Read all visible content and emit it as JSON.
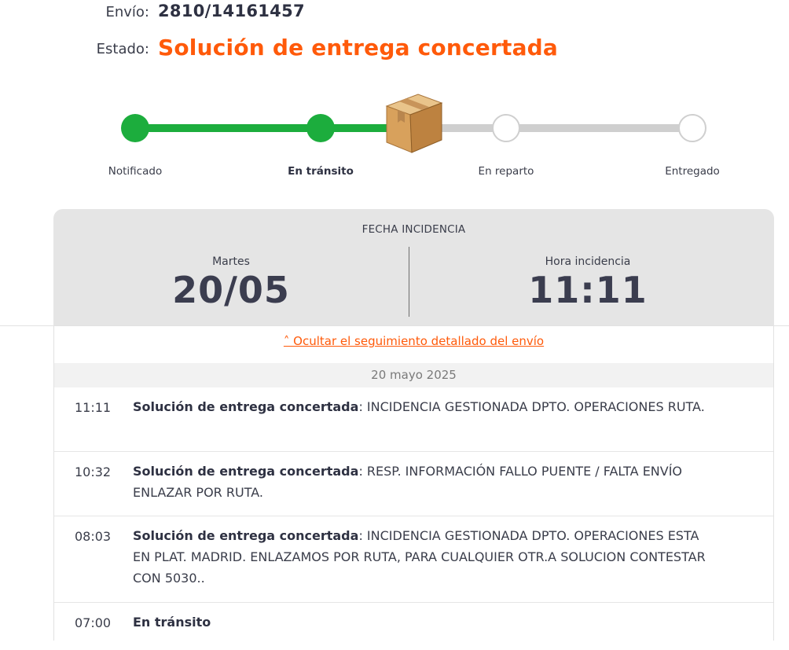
{
  "shipment": {
    "label": "Envío:",
    "number": "2810/14161457"
  },
  "status": {
    "label": "Estado:",
    "value": "Solución de entrega concertada",
    "color": "#ff5a0a"
  },
  "progress": {
    "done_color": "#1cad3d",
    "pending_color": "#cfcfcf",
    "current_icon": "package-box-icon",
    "steps": [
      {
        "label": "Notificado",
        "state": "done"
      },
      {
        "label": "En tránsito",
        "state": "current"
      },
      {
        "label": "En reparto",
        "state": "pending"
      },
      {
        "label": "Entregado",
        "state": "pending"
      }
    ]
  },
  "incident": {
    "title": "FECHA INCIDENCIA",
    "day_label": "Martes",
    "date": "20/05",
    "hour_label": "Hora incidencia",
    "hour": "11:11"
  },
  "tracking": {
    "toggle_label": "˄ Ocultar el seguimiento detallado del envío",
    "date_header": "20 mayo 2025",
    "events": [
      {
        "time": "11:11",
        "status": "Solución de entrega concertada",
        "separator": ":",
        "detail": " INCIDENCIA GESTIONADA DPTO. OPERACIONES RUTA."
      },
      {
        "time": "10:32",
        "status": "Solución de entrega concertada",
        "separator": ":",
        "detail": " RESP. INFORMACIÓN FALLO PUENTE / FALTA ENVÍO ENLAZAR POR RUTA."
      },
      {
        "time": "08:03",
        "status": "Solución de entrega concertada",
        "separator": ":",
        "detail": " INCIDENCIA GESTIONADA DPTO. OPERACIONES ESTA EN PLAT. MADRID. ENLAZAMOS POR RUTA, PARA CUALQUIER OTR.A SOLUCION CONTESTAR CON 5030.."
      },
      {
        "time": "07:00",
        "status": "En tránsito"
      }
    ]
  }
}
